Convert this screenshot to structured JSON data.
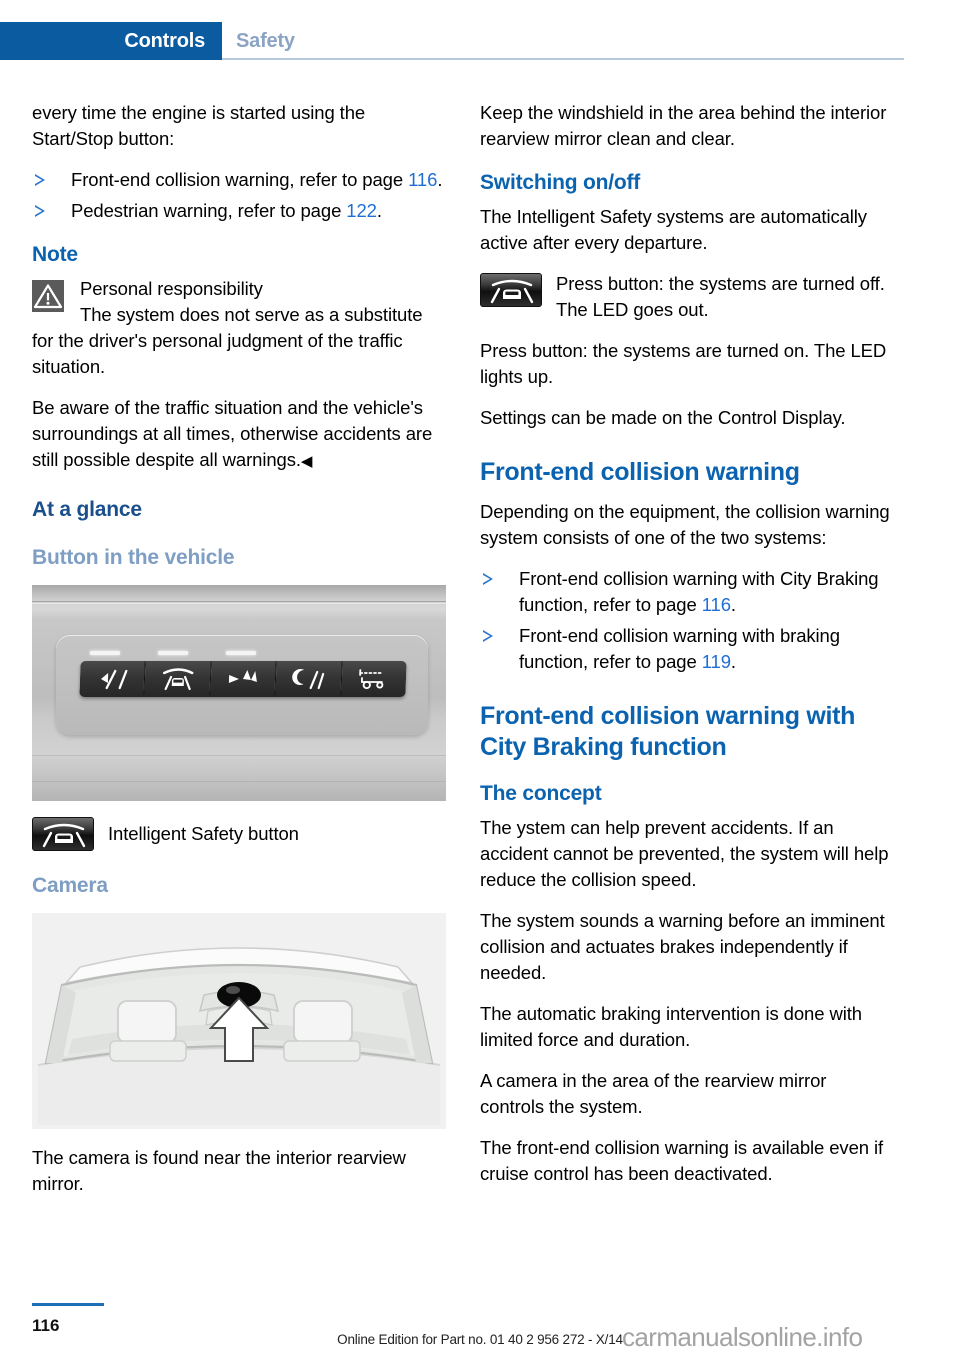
{
  "header": {
    "active_tab": "Controls",
    "inactive_tab": "Safety",
    "active_color": "#0b5ba1",
    "inactive_color": "#8ca4c4"
  },
  "left_column": {
    "intro_paragraph": "every time the engine is started using the Start/Stop button:",
    "intro_bullets": [
      {
        "text_before": "Front-end collision warning, refer to page ",
        "page_ref": "116",
        "text_after": "."
      },
      {
        "text_before": "Pedestrian warning, refer to page ",
        "page_ref": "122",
        "text_after": "."
      }
    ],
    "note_heading": "Note",
    "note_title": "Personal responsibility",
    "note_body_1": "The system does not serve as a substitute for the driver's personal judgment of the traffic situation.",
    "note_body_2": "Be aware of the traffic situation and the vehicle's surroundings at all times, otherwise accidents are still possible despite all warnings.",
    "note_endmark": "◀",
    "at_a_glance_heading": "At a glance",
    "button_in_vehicle_heading": "Button in the vehicle",
    "panel_figure_name": "dashboard button panel photo",
    "safety_button_caption": "Intelligent Safety button",
    "camera_heading": "Camera",
    "camera_figure_name": "windshield camera illustration",
    "camera_caption": "The camera is found near the interior rearview mirror."
  },
  "right_column": {
    "windshield_paragraph": "Keep the windshield in the area behind the interior rearview mirror clean and clear.",
    "switching_heading": "Switching on/off",
    "switching_paragraph": "The Intelligent Safety systems are automatically active after every departure.",
    "press_off_paragraph": "Press button: the systems are turned off. The LED goes out.",
    "press_on_paragraph": "Press button: the systems are turned on. The LED lights up.",
    "settings_paragraph": "Settings can be made on the Control Display.",
    "frontend_heading": "Front-end collision warning",
    "frontend_paragraph": "Depending on the equipment, the collision warning system consists of one of the two systems:",
    "frontend_bullets": [
      {
        "text_before": "Front-end collision warning with City Braking function, refer to page ",
        "page_ref": "116",
        "text_after": "."
      },
      {
        "text_before": "Front-end collision warning with braking function, refer to page ",
        "page_ref": "119",
        "text_after": "."
      }
    ],
    "city_braking_heading": "Front-end collision warning with City Braking function",
    "concept_heading": "The concept",
    "concept_p1": "The ystem can help prevent accidents. If an accident cannot be prevented, the system will help reduce the collision speed.",
    "concept_p2": "The system sounds a warning before an imminent collision and actuates brakes independently if needed.",
    "concept_p3": "The automatic braking intervention is done with limited force and duration.",
    "concept_p4": "A camera in the area of the rearview mirror controls the system.",
    "concept_p5": "The front-end collision warning is available even if cruise control has been deactivated."
  },
  "footer": {
    "page_number": "116",
    "edition_text": "Online Edition for Part no. 01 40 2 956 272 - X/14",
    "watermark": "carmanualsonline.info"
  },
  "colors": {
    "heading_blue": "#0b63b0",
    "heading_dark_blue": "#1b4f8c",
    "heading_light_blue": "#7e9ec4",
    "page_ref_blue": "#1f6fd4",
    "bullet_blue": "#2a77cc"
  }
}
